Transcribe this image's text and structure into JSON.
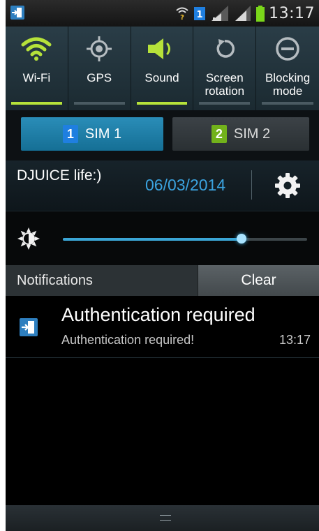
{
  "statusbar": {
    "time": "13:17",
    "left_icon": "login-door-icon",
    "icons": [
      "wifi-question-icon",
      "sim1-indicator-icon",
      "signal-icon",
      "signal-icon",
      "battery-icon"
    ]
  },
  "quick_settings": [
    {
      "label": "Wi-Fi",
      "icon": "wifi-icon",
      "on": true
    },
    {
      "label": "GPS",
      "icon": "gps-icon",
      "on": false
    },
    {
      "label": "Sound",
      "icon": "sound-icon",
      "on": true
    },
    {
      "label": "Screen rotation",
      "icon": "rotation-icon",
      "on": false
    },
    {
      "label": "Blocking mode",
      "icon": "blocking-icon",
      "on": false
    }
  ],
  "sim": {
    "sim1_label": "SIM 1",
    "sim1_num": "1",
    "sim2_label": "SIM 2",
    "sim2_num": "2"
  },
  "info": {
    "carrier": "DJUICE life:)",
    "date": "06/03/2014"
  },
  "brightness": {
    "level": 0.73
  },
  "notifications": {
    "header": "Notifications",
    "clear_label": "Clear",
    "items": [
      {
        "title": "Authentication required",
        "text": "Authentication required!",
        "time": "13:17",
        "icon": "login-door-icon"
      }
    ]
  },
  "colors": {
    "accent_on": "#b6e23a",
    "accent_blue": "#3ba3df",
    "sim1_blue": "#1f7fe0",
    "sim2_green": "#72b21b"
  }
}
